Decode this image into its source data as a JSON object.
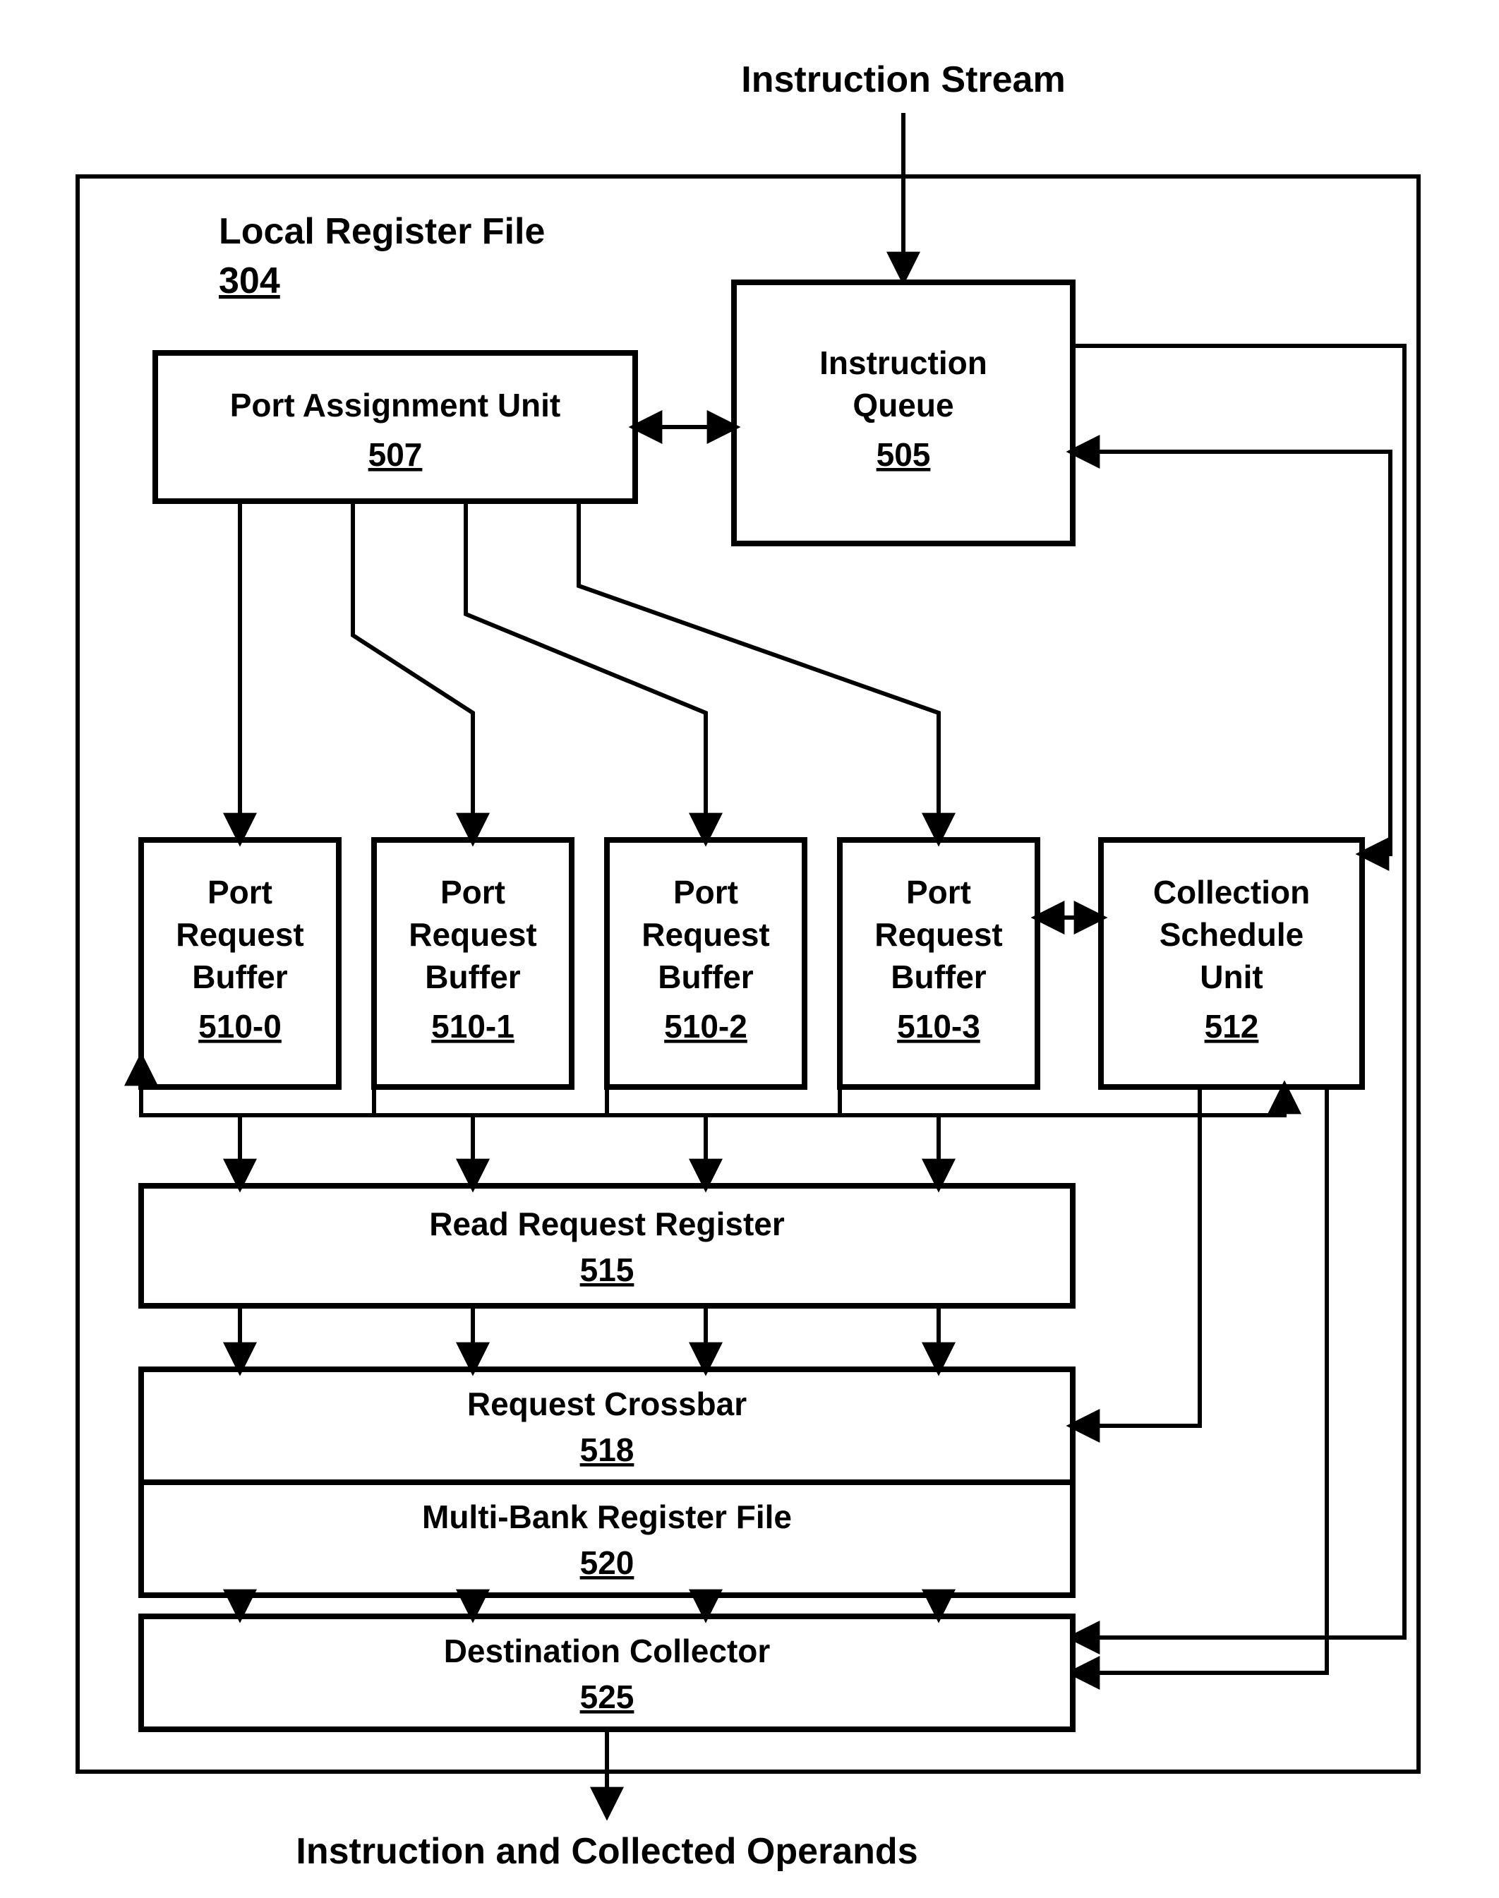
{
  "io": {
    "top": "Instruction Stream",
    "bottom": "Instruction and Collected Operands"
  },
  "outer": {
    "title": "Local Register File",
    "ref": "304"
  },
  "blocks": {
    "instruction_queue": {
      "l1": "Instruction",
      "l2": "Queue",
      "ref": "505"
    },
    "port_assignment": {
      "l1": "Port Assignment Unit",
      "ref": "507"
    },
    "prb0": {
      "l1": "Port",
      "l2": "Request",
      "l3": "Buffer",
      "ref": "510-0"
    },
    "prb1": {
      "l1": "Port",
      "l2": "Request",
      "l3": "Buffer",
      "ref": "510-1"
    },
    "prb2": {
      "l1": "Port",
      "l2": "Request",
      "l3": "Buffer",
      "ref": "510-2"
    },
    "prb3": {
      "l1": "Port",
      "l2": "Request",
      "l3": "Buffer",
      "ref": "510-3"
    },
    "csu": {
      "l1": "Collection",
      "l2": "Schedule",
      "l3": "Unit",
      "ref": "512"
    },
    "rrr": {
      "l1": "Read Request Register",
      "ref": "515"
    },
    "xbar": {
      "l1": "Request Crossbar",
      "ref": "518"
    },
    "mbrf": {
      "l1": "Multi-Bank Register File",
      "ref": "520"
    },
    "dc": {
      "l1": "Destination Collector",
      "ref": "525"
    }
  }
}
